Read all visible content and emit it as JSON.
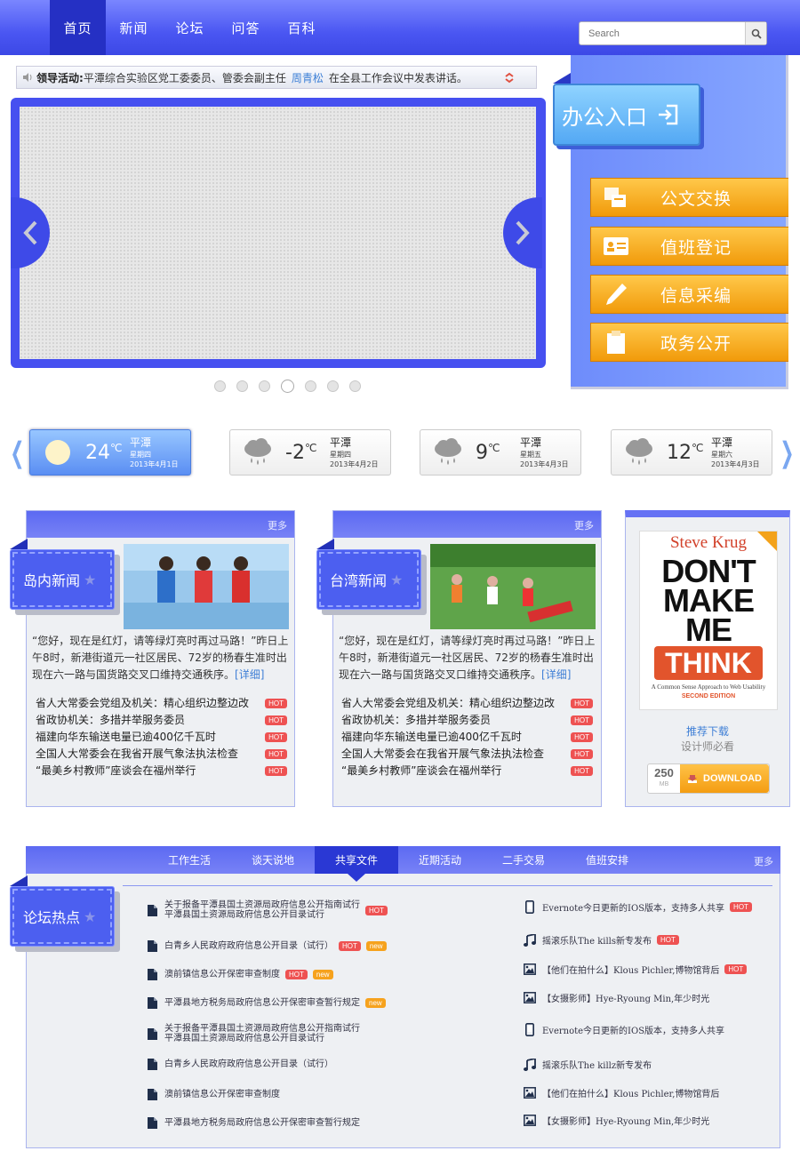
{
  "nav": {
    "items": [
      "首页",
      "新闻",
      "论坛",
      "问答",
      "百科"
    ],
    "active": 0
  },
  "search": {
    "placeholder": "Search"
  },
  "ticker": {
    "label": "领导活动:",
    "text1": "平潭综合实验区党工委委员、管委会副主任",
    "name": "周青松",
    "text2": "在全县工作会议中发表讲话。"
  },
  "office": {
    "title": "办公入口",
    "buttons": [
      "公文交换",
      "值班登记",
      "信息采编",
      "政务公开"
    ]
  },
  "weather": [
    {
      "temp": "24",
      "unit": "℃",
      "city": "平潭",
      "weekday": "星期四",
      "date": "2013年4月1日",
      "icon": "sun-icon",
      "active": true
    },
    {
      "temp": "-2",
      "unit": "℃",
      "city": "平潭",
      "weekday": "星期四",
      "date": "2013年4月2日",
      "icon": "rain-cloud-icon"
    },
    {
      "temp": "9",
      "unit": "℃",
      "city": "平潭",
      "weekday": "星期五",
      "date": "2013年4月3日",
      "icon": "rain-cloud-icon"
    },
    {
      "temp": "12",
      "unit": "℃",
      "city": "平潭",
      "weekday": "星期六",
      "date": "2013年4月3日",
      "icon": "rain-cloud-icon"
    }
  ],
  "news": [
    {
      "title": "岛内新闻",
      "more": "更多",
      "summary": "“您好，现在是红灯，请等绿灯亮时再过马路！”昨日上午8时，新港街道元一社区居民、72岁的杨春生准时出现在六一路与国货路交叉口维持交通秩序。",
      "detail": "[详细]",
      "items": [
        "省人大常委会党组及机关：精心组织边整边改",
        "省政协机关：多措并举服务委员",
        "福建向华东输送电量已逾400亿千瓦时",
        "全国人大常委会在我省开展气象法执法检查",
        "“最美乡村教师”座谈会在福州举行"
      ],
      "badge": "HOT"
    },
    {
      "title": "台湾新闻",
      "more": "更多",
      "summary": "“您好，现在是红灯，请等绿灯亮时再过马路！”昨日上午8时，新港街道元一社区居民、72岁的杨春生准时出现在六一路与国货路交叉口维持交通秩序。",
      "detail": "[详细]",
      "items": [
        "省人大常委会党组及机关：精心组织边整边改",
        "省政协机关：多措并举服务委员",
        "福建向华东输送电量已逾400亿千瓦时",
        "全国人大常委会在我省开展气象法执法检查",
        "“最美乡村教师”座谈会在福州举行"
      ],
      "badge": "HOT"
    }
  ],
  "book": {
    "author": "Steve Krug",
    "line1": "DON'T",
    "line2": "MAKE",
    "line3": "ME",
    "line4": "THINK",
    "subtitle": "A Common Sense Approach to Web Usability",
    "edition": "SECOND EDITION",
    "recommend": "推荐下载",
    "note": "设计师必看",
    "size": "250",
    "size_unit": "MB",
    "download": "DOWNLOAD"
  },
  "forum": {
    "title": "论坛热点",
    "tabs": [
      "工作生活",
      "谈天说地",
      "共享文件",
      "近期活动",
      "二手交易",
      "值班安排"
    ],
    "active_tab": 2,
    "more": "更多",
    "left": [
      {
        "lines": [
          "关于报备平潭县国土资源局政府信息公开指南试行",
          "平潭县国土资源局政府信息公开目录试行"
        ],
        "badges": [
          "HOT"
        ]
      },
      {
        "lines": [
          "白青乡人民政府政府信息公开目录（试行）"
        ],
        "badges": [
          "HOT",
          "new"
        ]
      },
      {
        "lines": [
          "澳前镇信息公开保密审查制度"
        ],
        "badges": [
          "HOT",
          "new"
        ]
      },
      {
        "lines": [
          "平潭县地方税务局政府信息公开保密审查暂行规定"
        ],
        "badges": [
          "new"
        ]
      },
      {
        "lines": [
          "关于报备平潭县国土资源局政府信息公开指南试行",
          "平潭县国土资源局政府信息公开目录试行"
        ],
        "badges": []
      },
      {
        "lines": [
          "白青乡人民政府政府信息公开目录（试行）"
        ],
        "badges": []
      },
      {
        "lines": [
          "澳前镇信息公开保密审查制度"
        ],
        "badges": []
      },
      {
        "lines": [
          "平潭县地方税务局政府信息公开保密审查暂行规定"
        ],
        "badges": []
      }
    ],
    "right": [
      {
        "icon": "phone-icon",
        "text": "Evernote今日更新的IOS版本，支持多人共享",
        "badges": [
          "HOT"
        ]
      },
      {
        "icon": "music-icon",
        "text": "摇滚乐队The kills新专发布",
        "badges": [
          "HOT"
        ]
      },
      {
        "icon": "image-icon",
        "text": "【他们在拍什么】Klous Pichler,博物馆背后",
        "badges": [
          "HOT"
        ]
      },
      {
        "icon": "image-icon",
        "text": "【女摄影师】Hye-Ryoung Min,年少时光",
        "badges": []
      },
      {
        "icon": "phone-icon",
        "text": "Evernote今日更新的IOS版本，支持多人共享",
        "badges": []
      },
      {
        "icon": "music-icon",
        "text": "摇滚乐队The killz新专发布",
        "badges": []
      },
      {
        "icon": "image-icon",
        "text": "【他们在拍什么】Klous Pichler,博物馆背后",
        "badges": []
      },
      {
        "icon": "image-icon",
        "text": "【女摄影师】Hye-Ryoung Min,年少时光",
        "badges": []
      }
    ]
  },
  "colors": {
    "primary": "#4a56f2",
    "accent": "#f19a0a",
    "hot": "#ee5252",
    "new": "#f6a21d",
    "link": "#3c7fd6"
  }
}
